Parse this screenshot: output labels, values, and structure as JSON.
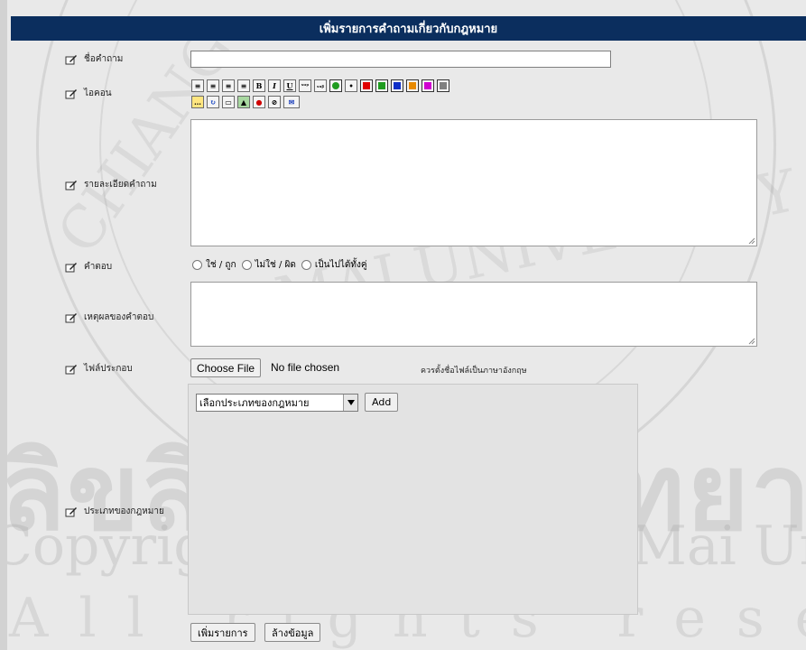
{
  "header": {
    "title": "เพิ่มรายการคำถามเกี่ยวกับกฎหมาย"
  },
  "form": {
    "question_title_label": "ชื่อคำถาม",
    "question_title_value": "",
    "icon_label": "ไอคอน",
    "detail_label": "รายละเอียดคำถาม",
    "detail_value": "",
    "answer_label": "คำตอบ",
    "answer_options": [
      "ใช่ / ถูก",
      "ไม่ใช่ / ผิด",
      "เป็นไปได้ทั้งคู่"
    ],
    "reason_label": "เหตุผลของคำตอบ",
    "reason_value": "",
    "attachment_label": "ไฟล์ประกอบ",
    "choose_file_label": "Choose File",
    "no_file_text": "No file chosen",
    "file_note": "ควรตั้งชื่อไฟล์เป็นภาษาอังกฤษ",
    "law_type_label": "ประเภทของกฎหมาย",
    "law_type_select": "เลือกประเภทของกฎหมาย",
    "add_label": "Add",
    "submit_label": "เพิ่มรายการ",
    "clear_label": "ล้างข้อมูล"
  },
  "toolbar": {
    "row1": [
      "align-left-icon",
      "align-center-icon",
      "align-right-icon",
      "align-justify-icon",
      "bold-icon",
      "italic-icon",
      "underline-icon",
      "superscript-icon",
      "subscript-icon",
      "insert-image-icon",
      "hr-icon",
      "color-red-icon",
      "color-green-icon",
      "color-blue-icon",
      "color-orange-icon",
      "color-magenta-icon",
      "color-gray-icon"
    ],
    "row2": [
      "comment-icon",
      "refresh-icon",
      "frame-icon",
      "picture-icon",
      "bomb-icon",
      "strike-icon",
      "email-icon"
    ],
    "bold_glyph": "B",
    "italic_glyph": "I",
    "underline_glyph": "U",
    "colors": [
      "#e00000",
      "#1f9c1f",
      "#1030c8",
      "#e88a00",
      "#d000d0",
      "#808080"
    ]
  },
  "watermark": {
    "thai": "ลิขสิทธิ์มหาวิทยาลัยเชียงใหม่",
    "copyright": "Copyright© by Chiang Mai University",
    "rights": "All rights reserved"
  }
}
